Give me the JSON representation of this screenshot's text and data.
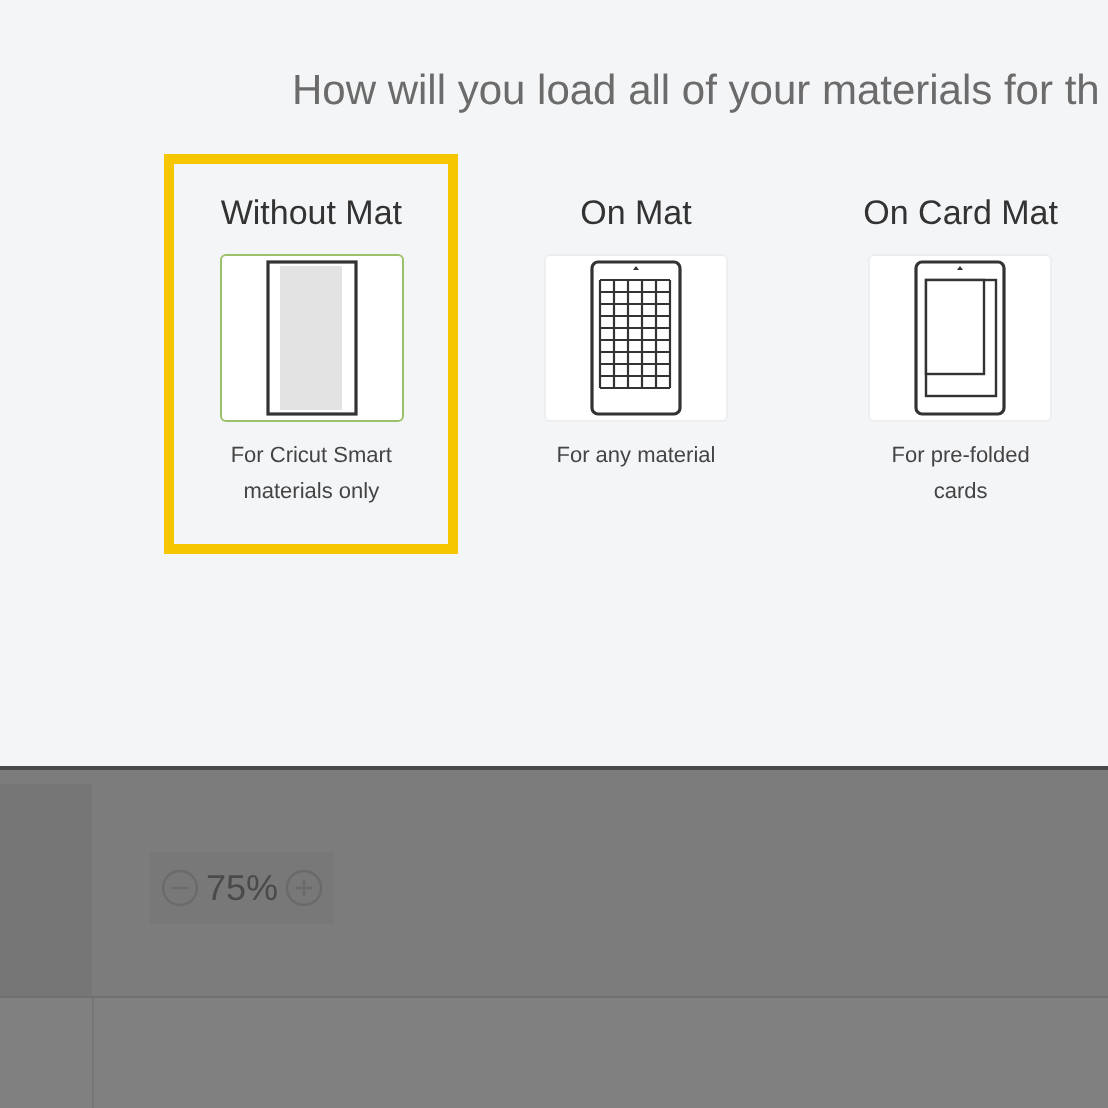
{
  "heading": "How will you load all of your materials for th",
  "options": [
    {
      "kind": "no-mat",
      "title": "Without Mat",
      "description": "For Cricut Smart materials only",
      "selected": true
    },
    {
      "kind": "grid-mat",
      "title": "On Mat",
      "description": "For any material",
      "selected": false
    },
    {
      "kind": "card-mat",
      "title": "On Card Mat",
      "description": "For pre-folded cards",
      "selected": false
    }
  ],
  "zoom": {
    "value": "75%"
  }
}
